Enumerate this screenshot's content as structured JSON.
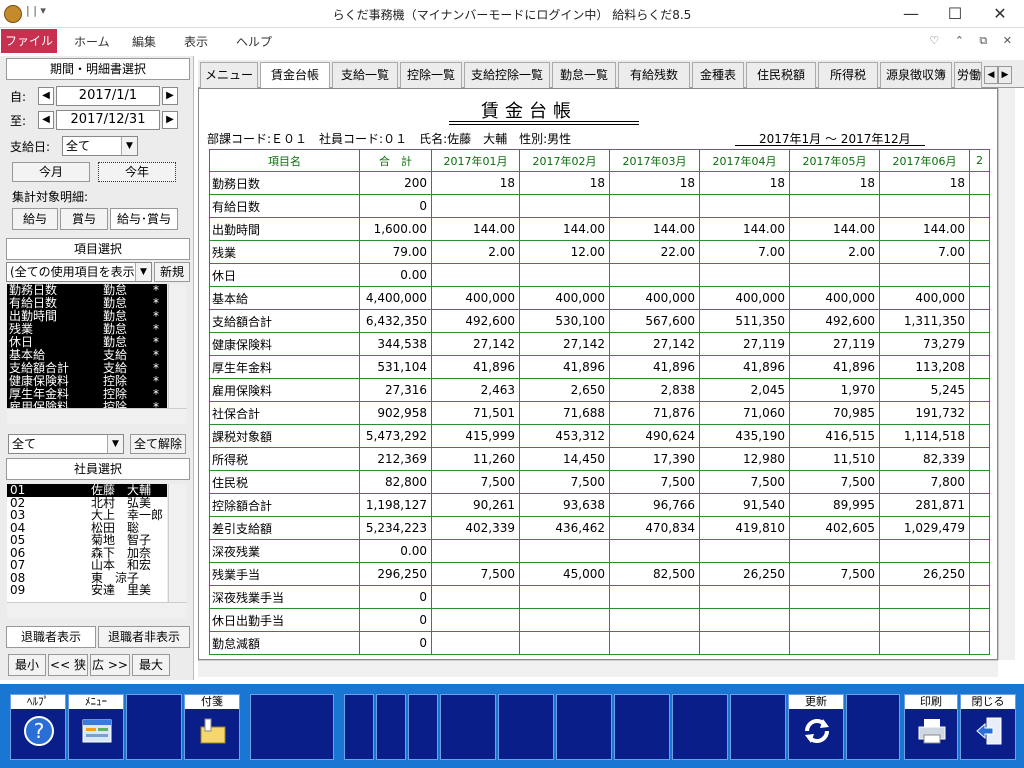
{
  "window": {
    "title": "らくだ事務機（マイナンバーモードにログイン中） 給料らくだ8.5",
    "minimize": "—",
    "maximize": "☐",
    "close": "✕"
  },
  "menu": {
    "file": "ファイル",
    "items": [
      "ホーム",
      "編集",
      "表示",
      "ヘルプ"
    ]
  },
  "left": {
    "period_header": "期間・明細書選択",
    "from_label": "自:",
    "from_date": "2017/1/1",
    "to_label": "至:",
    "to_date": "2017/12/31",
    "payday_label": "支給日:",
    "payday_value": "全て",
    "this_month": "今月",
    "this_year": "今年",
    "target_label": "集計対象明細:",
    "target_buttons": [
      "給与",
      "賞与",
      "給与･賞与"
    ],
    "item_header": "項目選択",
    "item_filter": "(全ての使用項目を表示)",
    "new_button": "新規",
    "items": [
      {
        "name": "勤務日数",
        "type": "勤怠",
        "mark": "*"
      },
      {
        "name": "有給日数",
        "type": "勤怠",
        "mark": "*"
      },
      {
        "name": "出勤時間",
        "type": "勤怠",
        "mark": "*"
      },
      {
        "name": "残業",
        "type": "勤怠",
        "mark": "*"
      },
      {
        "name": "休日",
        "type": "勤怠",
        "mark": "*"
      },
      {
        "name": "基本給",
        "type": "支給",
        "mark": "*"
      },
      {
        "name": "支給額合計",
        "type": "支給",
        "mark": "*"
      },
      {
        "name": "健康保険料",
        "type": "控除",
        "mark": "*"
      },
      {
        "name": "厚生年金料",
        "type": "控除",
        "mark": "*"
      },
      {
        "name": "雇用保険料",
        "type": "控除",
        "mark": "*"
      }
    ],
    "filter2": "全て",
    "clear_all": "全て解除",
    "employee_header": "社員選択",
    "employees": [
      {
        "code": "01",
        "name": "佐藤　大輔"
      },
      {
        "code": "02",
        "name": "北村　弘美"
      },
      {
        "code": "03",
        "name": "大上　幸一郎"
      },
      {
        "code": "04",
        "name": "松田　聡"
      },
      {
        "code": "05",
        "name": "菊地　智子"
      },
      {
        "code": "06",
        "name": "森下　加奈"
      },
      {
        "code": "07",
        "name": "山本　和宏"
      },
      {
        "code": "08",
        "name": "東　涼子"
      },
      {
        "code": "09",
        "name": "安達　里美"
      }
    ],
    "show_retired": "退職者表示",
    "hide_retired": "退職者非表示",
    "zoom_buttons": [
      "最小",
      "<< 狭",
      "広 >>",
      "最大"
    ]
  },
  "tabs": [
    "メニュー",
    "賃金台帳",
    "支給一覧",
    "控除一覧",
    "支給控除一覧",
    "勤怠一覧",
    "有給残数",
    "金種表",
    "住民税額",
    "所得税",
    "源泉徴収簿",
    "労働"
  ],
  "active_tab": 1,
  "report": {
    "title": "賃金台帳",
    "info_left": "部課コード:Ｅ０１　社員コード:０１　氏名:佐藤　大輔　性別:男性",
    "info_right": "2017年1月 〜 2017年12月",
    "columns": [
      "項目名",
      "合　計",
      "2017年01月",
      "2017年02月",
      "2017年03月",
      "2017年04月",
      "2017年05月",
      "2017年06月",
      "2"
    ],
    "rows": [
      [
        "勤務日数",
        "200",
        "18",
        "18",
        "18",
        "18",
        "18",
        "18"
      ],
      [
        "有給日数",
        "0",
        "",
        "",
        "",
        "",
        "",
        ""
      ],
      [
        "出勤時間",
        "1,600.00",
        "144.00",
        "144.00",
        "144.00",
        "144.00",
        "144.00",
        "144.00"
      ],
      [
        "残業",
        "79.00",
        "2.00",
        "12.00",
        "22.00",
        "7.00",
        "2.00",
        "7.00"
      ],
      [
        "休日",
        "0.00",
        "",
        "",
        "",
        "",
        "",
        ""
      ],
      [
        "基本給",
        "4,400,000",
        "400,000",
        "400,000",
        "400,000",
        "400,000",
        "400,000",
        "400,000"
      ],
      [
        "支給額合計",
        "6,432,350",
        "492,600",
        "530,100",
        "567,600",
        "511,350",
        "492,600",
        "1,311,350"
      ],
      [
        "健康保険料",
        "344,538",
        "27,142",
        "27,142",
        "27,142",
        "27,119",
        "27,119",
        "73,279"
      ],
      [
        "厚生年金料",
        "531,104",
        "41,896",
        "41,896",
        "41,896",
        "41,896",
        "41,896",
        "113,208"
      ],
      [
        "雇用保険料",
        "27,316",
        "2,463",
        "2,650",
        "2,838",
        "2,045",
        "1,970",
        "5,245"
      ],
      [
        "社保合計",
        "902,958",
        "71,501",
        "71,688",
        "71,876",
        "71,060",
        "70,985",
        "191,732"
      ],
      [
        "課税対象額",
        "5,473,292",
        "415,999",
        "453,312",
        "490,624",
        "435,190",
        "416,515",
        "1,114,518"
      ],
      [
        "所得税",
        "212,369",
        "11,260",
        "14,450",
        "17,390",
        "12,980",
        "11,510",
        "82,339"
      ],
      [
        "住民税",
        "82,800",
        "7,500",
        "7,500",
        "7,500",
        "7,500",
        "7,500",
        "7,800"
      ],
      [
        "控除額合計",
        "1,198,127",
        "90,261",
        "93,638",
        "96,766",
        "91,540",
        "89,995",
        "281,871"
      ],
      [
        "差引支給額",
        "5,234,223",
        "402,339",
        "436,462",
        "470,834",
        "419,810",
        "402,605",
        "1,029,479"
      ],
      [
        "深夜残業",
        "0.00",
        "",
        "",
        "",
        "",
        "",
        ""
      ],
      [
        "残業手当",
        "296,250",
        "7,500",
        "45,000",
        "82,500",
        "26,250",
        "7,500",
        "26,250"
      ],
      [
        "深夜残業手当",
        "0",
        "",
        "",
        "",
        "",
        "",
        ""
      ],
      [
        "休日出勤手当",
        "0",
        "",
        "",
        "",
        "",
        "",
        ""
      ],
      [
        "勤怠減額",
        "0",
        "",
        "",
        "",
        "",
        "",
        ""
      ]
    ]
  },
  "fkeys": [
    {
      "label": "ﾍﾙﾌﾟ",
      "icon": "help-icon"
    },
    {
      "label": "ﾒﾆｭｰ",
      "icon": "menu-icon"
    },
    {
      "label": "",
      "icon": ""
    },
    {
      "label": "付箋",
      "icon": "sticky-note-icon"
    },
    {
      "label": "更新",
      "icon": "refresh-icon"
    },
    {
      "label": "印刷",
      "icon": "printer-icon"
    },
    {
      "label": "閉じる",
      "icon": "exit-icon"
    }
  ]
}
